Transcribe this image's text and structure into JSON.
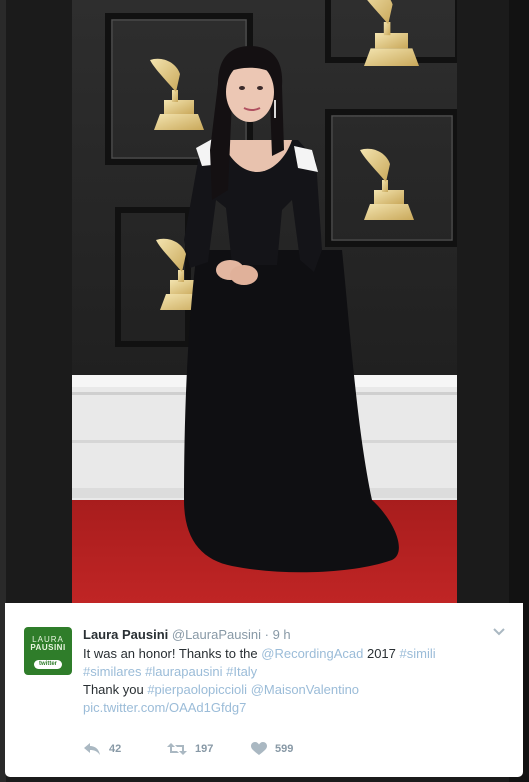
{
  "tweet": {
    "author": {
      "name": "Laura Pausini",
      "handle": "@LauraPausini"
    },
    "separator": "·",
    "time": "9 h",
    "avatar": {
      "line1": "LAURA",
      "line2": "PAUSINI",
      "badge": "twitter"
    },
    "text": {
      "l1_a": "It was an honor! Thanks to the ",
      "l1_mention": "@RecordingAcad",
      "l1_b": " 2017 ",
      "l1_tag": "#simili",
      "l2_tag1": "#similares",
      "l2_tag2": "#laurapausini",
      "l2_tag3": "#Italy",
      "l3_a": "Thank you ",
      "l3_tag": "#pierpaolopiccioli",
      "l3_mention": "@MaisonValentino",
      "l4_link": "pic.twitter.com/OAAd1Gfdg7"
    },
    "actions": {
      "reply_count": "42",
      "retweet_count": "197",
      "like_count": "599"
    }
  },
  "colors": {
    "link": "#9bbcd8",
    "name": "#292f33",
    "meta": "#8899a6",
    "carpet": "#b01f1f",
    "backdrop": "#2b2b2b",
    "avatar_green": "#2f7d2a"
  },
  "icons": [
    "reply-icon",
    "retweet-icon",
    "heart-icon",
    "chevron-down-icon",
    "grammy-icon"
  ]
}
